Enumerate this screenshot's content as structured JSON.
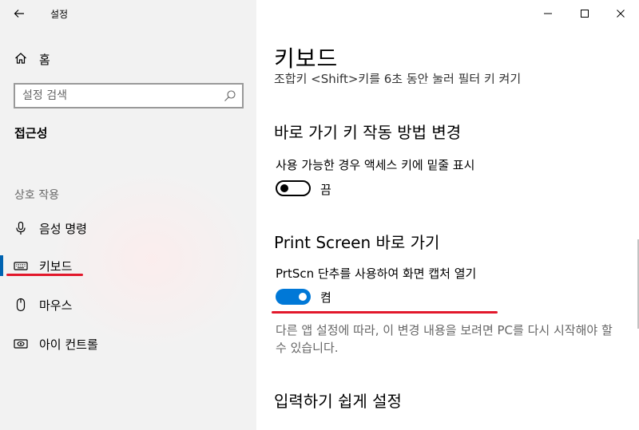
{
  "app": {
    "title": "설정"
  },
  "sidebar": {
    "home_label": "홈",
    "search_placeholder": "설정 검색",
    "category": "접근성",
    "section_label": "상호 작용",
    "items": [
      {
        "label": "음성 명령",
        "icon": "microphone-icon"
      },
      {
        "label": "키보드",
        "icon": "keyboard-icon",
        "active": true
      },
      {
        "label": "마우스",
        "icon": "mouse-icon"
      },
      {
        "label": "아이 컨트롤",
        "icon": "eye-control-icon"
      }
    ]
  },
  "content": {
    "page_title": "키보드",
    "cutoff_text": "조합키 <Shift>키를 6초 동안 눌러 필터 키 켜기",
    "shortcut_section": {
      "heading": "바로 가기 키 작동 방법 변경",
      "setting_label": "사용 가능한 경우 액세스 키에 밑줄 표시",
      "toggle_state": "끔",
      "toggle_on": false
    },
    "printscreen_section": {
      "heading": "Print Screen 바로 가기",
      "setting_label": "PrtScn 단추를 사용하여 화면 캡처 열기",
      "toggle_state": "켬",
      "toggle_on": true,
      "note": "다른 앱 설정에 따라, 이 변경 내용을 보려면 PC를 다시 시작해야 할 수 있습니다."
    },
    "easy_input_heading": "입력하기 쉽게 설정"
  },
  "colors": {
    "accent": "#0078d7",
    "highlight_underline": "#e2182b",
    "sidebar_bg": "#f2f2f2"
  }
}
